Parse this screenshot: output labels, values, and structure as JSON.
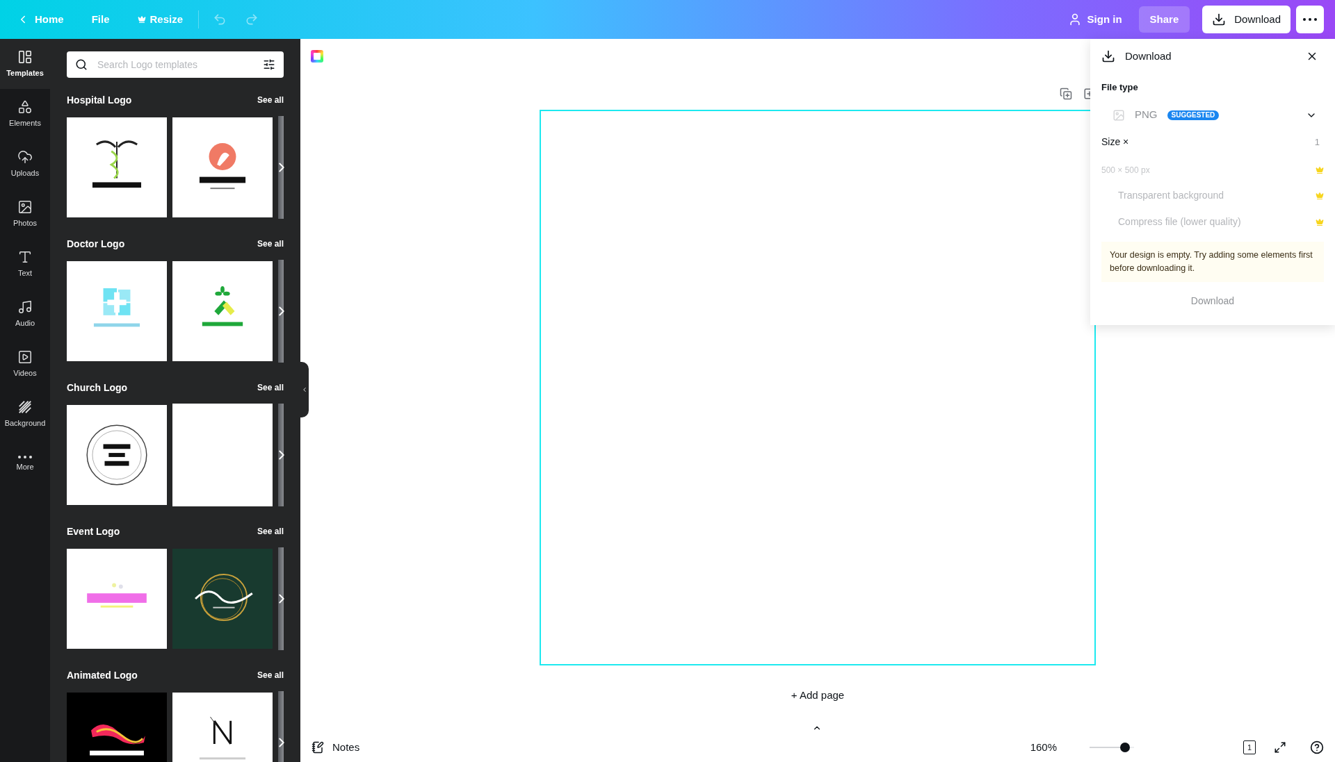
{
  "topbar": {
    "home": "Home",
    "file": "File",
    "resize": "Resize",
    "sign_in": "Sign in",
    "share": "Share",
    "download": "Download"
  },
  "nav": [
    {
      "label": "Templates",
      "selected": true
    },
    {
      "label": "Elements",
      "selected": false
    },
    {
      "label": "Uploads",
      "selected": false
    },
    {
      "label": "Photos",
      "selected": false
    },
    {
      "label": "Text",
      "selected": false
    },
    {
      "label": "Audio",
      "selected": false
    },
    {
      "label": "Videos",
      "selected": false
    },
    {
      "label": "Background",
      "selected": false
    },
    {
      "label": "More",
      "selected": false
    }
  ],
  "search": {
    "placeholder": "Search Logo templates"
  },
  "sections": [
    {
      "title": "Hospital Logo",
      "see_all": "See all",
      "thumbnails": [
        {
          "kind": "picture"
        },
        {
          "kind": "picture"
        }
      ]
    },
    {
      "title": "Doctor Logo",
      "see_all": "See all",
      "thumbnails": [
        {
          "kind": "picture"
        },
        {
          "kind": "picture"
        }
      ]
    },
    {
      "title": "Church Logo",
      "see_all": "See all",
      "thumbnails": [
        {
          "kind": "picture"
        },
        {
          "kind": "blank"
        }
      ]
    },
    {
      "title": "Event Logo",
      "see_all": "See all",
      "thumbnails": [
        {
          "kind": "picture"
        },
        {
          "kind": "picture"
        }
      ]
    },
    {
      "title": "Animated Logo",
      "see_all": "See all",
      "thumbnails": [
        {
          "kind": "picture"
        },
        {
          "kind": "picture"
        }
      ]
    }
  ],
  "canvas": {
    "add_page": "+ Add page"
  },
  "download_panel": {
    "title": "Download",
    "file_type_label": "File type",
    "file_type": "PNG",
    "badge": "SUGGESTED",
    "size_label": "Size ×",
    "size_value": "1",
    "dimensions": "500 × 500 px",
    "options": [
      "Transparent background",
      "Compress file (lower quality)"
    ],
    "warning": "Your design is empty. Try adding some elements first before downloading it.",
    "button": "Download"
  },
  "bottom_bar": {
    "notes": "Notes",
    "zoom": "160%",
    "zoom_slider": {
      "level": 0.8
    },
    "page_count": "1"
  }
}
